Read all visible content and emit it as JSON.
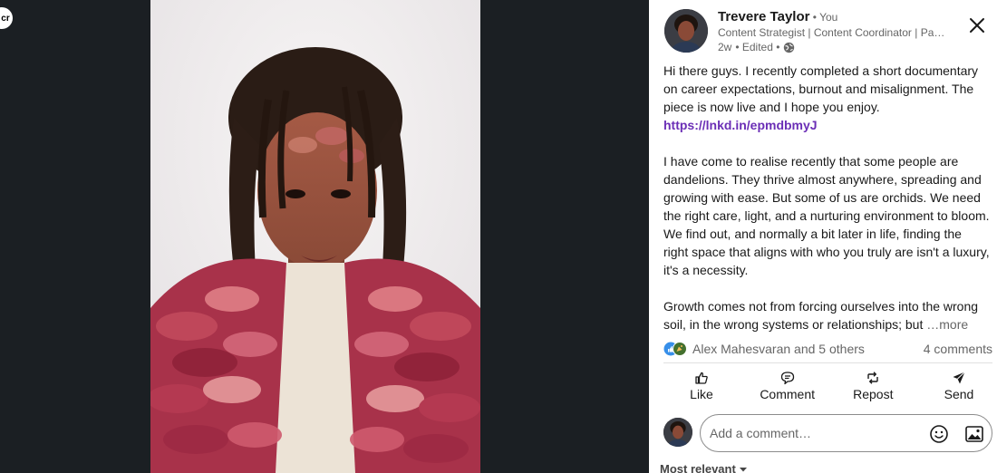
{
  "media": {
    "logo_text": "cr"
  },
  "author": {
    "name": "Trevere Taylor",
    "relation": " • You",
    "headline": "Content Strategist | Content Coordinator | Passionate about storytelling",
    "time": "2w",
    "edited": "• Edited •",
    "visibility_icon": "globe-icon"
  },
  "post": {
    "p1_text": "Hi there guys. I recently completed a short documentary on career expectations, burnout and misalignment. The piece is now live and I hope you enjoy. ",
    "p1_link": "https://lnkd.in/epmdbmyJ",
    "p2": "I have come to realise recently that some people are dandelions. They thrive almost anywhere, spreading and growing with ease. But some of us are orchids. We need the right care, light, and a nurturing environment to bloom. We find out, and normally a bit later in life, finding the right space that aligns with who you truly are isn't a luxury, it's a necessity.",
    "p3_text": "Growth comes not from forcing ourselves into the wrong soil, in the wrong systems or relationships; but ",
    "more": "…more"
  },
  "reactions": {
    "names": "Alex Mahesvaran and 5 others",
    "comments": "4 comments",
    "icons": [
      "like-icon",
      "celebrate-icon"
    ]
  },
  "actions": {
    "like": "Like",
    "comment": "Comment",
    "repost": "Repost",
    "send": "Send"
  },
  "comment_box": {
    "placeholder": "Add a comment…"
  },
  "sort": {
    "label": "Most relevant"
  },
  "colors": {
    "link": "#6b2fb6",
    "panel_bg": "#ffffff",
    "backdrop": "#1b1f23"
  }
}
